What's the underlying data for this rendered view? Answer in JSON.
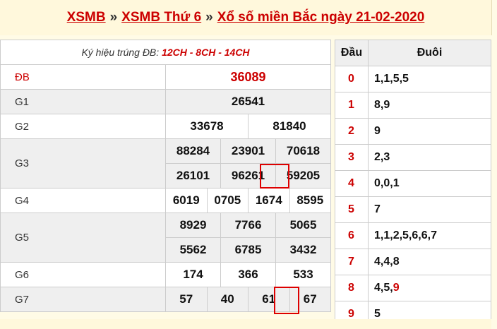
{
  "header": {
    "crumb1": "XSMB",
    "sep": "»",
    "crumb2": "XSMB Thứ 6",
    "crumb3": "Xổ số miền Bắc ngày 21-02-2020"
  },
  "kyhieu": {
    "label": "Ký hiệu trúng ĐB:",
    "value": "12CH - 8CH - 14CH"
  },
  "prizes": {
    "db": {
      "label": "ĐB",
      "numbers": [
        "36089"
      ]
    },
    "g1": {
      "label": "G1",
      "numbers": [
        "26541"
      ]
    },
    "g2": {
      "label": "G2",
      "numbers": [
        "33678",
        "81840"
      ]
    },
    "g3": {
      "label": "G3",
      "numbers": [
        "88284",
        "23901",
        "70618",
        "26101",
        "96261",
        "59205"
      ]
    },
    "g4": {
      "label": "G4",
      "numbers": [
        "6019",
        "0705",
        "1674",
        "8595"
      ]
    },
    "g5": {
      "label": "G5",
      "numbers": [
        "8929",
        "7766",
        "5065",
        "5562",
        "6785",
        "3432"
      ]
    },
    "g6": {
      "label": "G6",
      "numbers": [
        "174",
        "366",
        "533"
      ]
    },
    "g7": {
      "label": "G7",
      "numbers": [
        "57",
        "40",
        "61",
        "67"
      ]
    }
  },
  "dauduoi": {
    "head_label": "Đầu",
    "tail_label": "Đuôi",
    "rows": [
      {
        "dau": "0",
        "duoi": "1,1,5,5"
      },
      {
        "dau": "1",
        "duoi": "8,9"
      },
      {
        "dau": "2",
        "duoi": "9"
      },
      {
        "dau": "3",
        "duoi": "2,3"
      },
      {
        "dau": "4",
        "duoi": "0,0,1"
      },
      {
        "dau": "5",
        "duoi": "7"
      },
      {
        "dau": "6",
        "duoi": "1,1,2,5,6,6,7"
      },
      {
        "dau": "7",
        "duoi": "4,4,8"
      },
      {
        "dau": "8",
        "duoi": "4,5,",
        "duoi_highlight": "9"
      },
      {
        "dau": "9",
        "duoi": "5"
      }
    ]
  },
  "colors": {
    "accent_red": "#cc0000",
    "header_bg": "#fff8dc",
    "alt_row": "#efefef",
    "highlight_box": "#dd0000"
  }
}
